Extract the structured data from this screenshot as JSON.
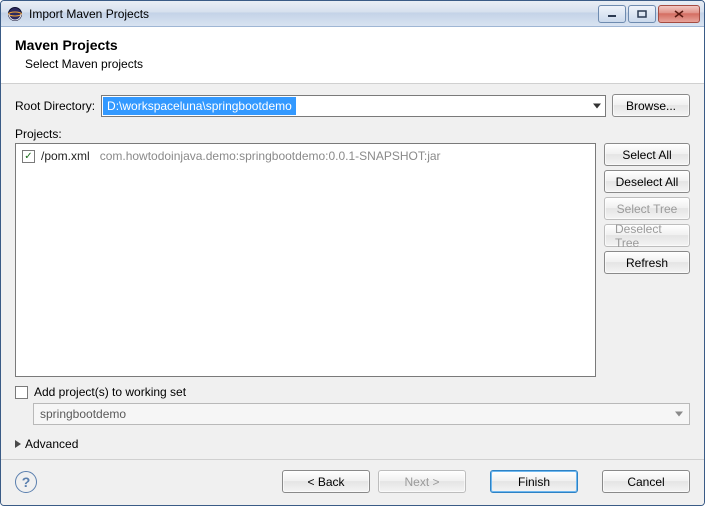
{
  "window": {
    "title": "Import Maven Projects"
  },
  "header": {
    "title": "Maven Projects",
    "subtitle": "Select Maven projects"
  },
  "rootDir": {
    "label": "Root Directory:",
    "value": "D:\\workspaceluna\\springbootdemo",
    "browse": "Browse..."
  },
  "projects": {
    "label": "Projects:",
    "items": [
      {
        "checked": true,
        "path": "/pom.xml",
        "coords": "com.howtodoinjava.demo:springbootdemo:0.0.1-SNAPSHOT:jar"
      }
    ],
    "buttons": {
      "selectAll": "Select All",
      "deselectAll": "Deselect All",
      "selectTree": "Select Tree",
      "deselectTree": "Deselect Tree",
      "refresh": "Refresh"
    }
  },
  "workingSet": {
    "checkboxLabel": "Add project(s) to working set",
    "value": "springbootdemo"
  },
  "advanced": {
    "label": "Advanced"
  },
  "footer": {
    "back": "< Back",
    "next": "Next >",
    "finish": "Finish",
    "cancel": "Cancel"
  }
}
